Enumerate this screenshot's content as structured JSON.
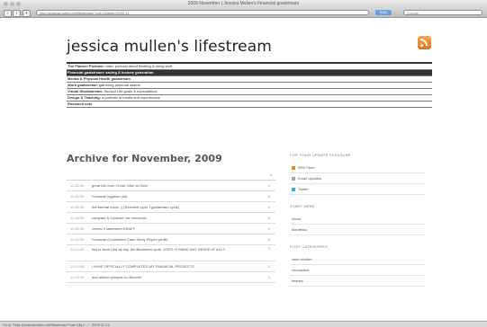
{
  "window": {
    "title": "2009 November | Jessica Mullen's Financial goalstream"
  },
  "toolbar": {
    "url": "http://jessicamullen.net/lifestream/?cat=1&date=2009-11",
    "rss_label": "RSS",
    "search_placeholder": "Google"
  },
  "site": {
    "title": "jessica mullen's lifestream"
  },
  "nav": [
    {
      "bold": "The Planner Podcast:",
      "text": " video podcast about thinking & doing stuff",
      "active": false
    },
    {
      "bold": "Financial goalstream: saving & income generation",
      "text": "",
      "active": true
    },
    {
      "bold": "Mental & Physical Health goalstream",
      "text": "",
      "active": false
    },
    {
      "bold": "Work goalstream:",
      "text": " gathering personal assets",
      "active": false
    },
    {
      "bold": "Virtual Worldstream:",
      "text": " Second Life goals & expectations",
      "active": false
    },
    {
      "bold": "Design & Teaching:",
      "text": " a portfolio of media and experiences",
      "active": false
    },
    {
      "bold": "Research sets",
      "text": "",
      "active": false
    }
  ],
  "archive": {
    "title": "Archive for November, 2009",
    "header_count": "#",
    "posts": [
      {
        "time": "11:30:09",
        "title": "great link from Christ- Man vs Debt",
        "count": "0"
      },
      {
        "time": "11:30:09",
        "title": "Financial hygiene (##)",
        "count": "0"
      },
      {
        "time": "11:30:09",
        "title": "the eternal return :) (Reinvent cycle I goalstream cycle)",
        "count": "0"
      },
      {
        "time": "11:28:09",
        "title": "compare & contrast: car insurance",
        "count": "0"
      },
      {
        "time": "11:26:09",
        "title": "review 2 statement DRAFT",
        "count": "0"
      },
      {
        "time": "11:26:09",
        "title": "Financial Goalstream Case Study Report (draft)",
        "count": "0"
      },
      {
        "time": "11:24:09",
        "title": "this is what i did all day, the lifestream cycle, DOES IT MAKE ANY SENSE AT ALL?!",
        "count": "0",
        "tall": true
      },
      {
        "time": "11:23:09",
        "title": "I HAVE OFFICIALLY COMPLETED MY FINANCIAL PROJECTS",
        "count": "0"
      },
      {
        "time": "11:23:09",
        "title": "and added synapse to discover",
        "count": "0"
      }
    ]
  },
  "sidebar": {
    "updates_heading": "For your update pleasure",
    "updates": [
      {
        "label": "RSS Feed",
        "icon": "rss-icon",
        "color": "#e8852b"
      },
      {
        "label": "Email Updates",
        "icon": "email-icon",
        "color": "#9aa6b4"
      },
      {
        "label": "Twitter",
        "icon": "twitter-icon",
        "color": "#39a8dd"
      }
    ],
    "start_heading": "Start here",
    "start_items": [
      "About",
      "Manifesto"
    ],
    "categories_heading": "Post categories",
    "categories": [
      "case studies",
      "conceptual",
      "finance"
    ]
  },
  "statusbar": {
    "text": "Go to \"http://jessicamullen.net/lifestream/?cat=1&p=...\", 2009 11 24"
  }
}
